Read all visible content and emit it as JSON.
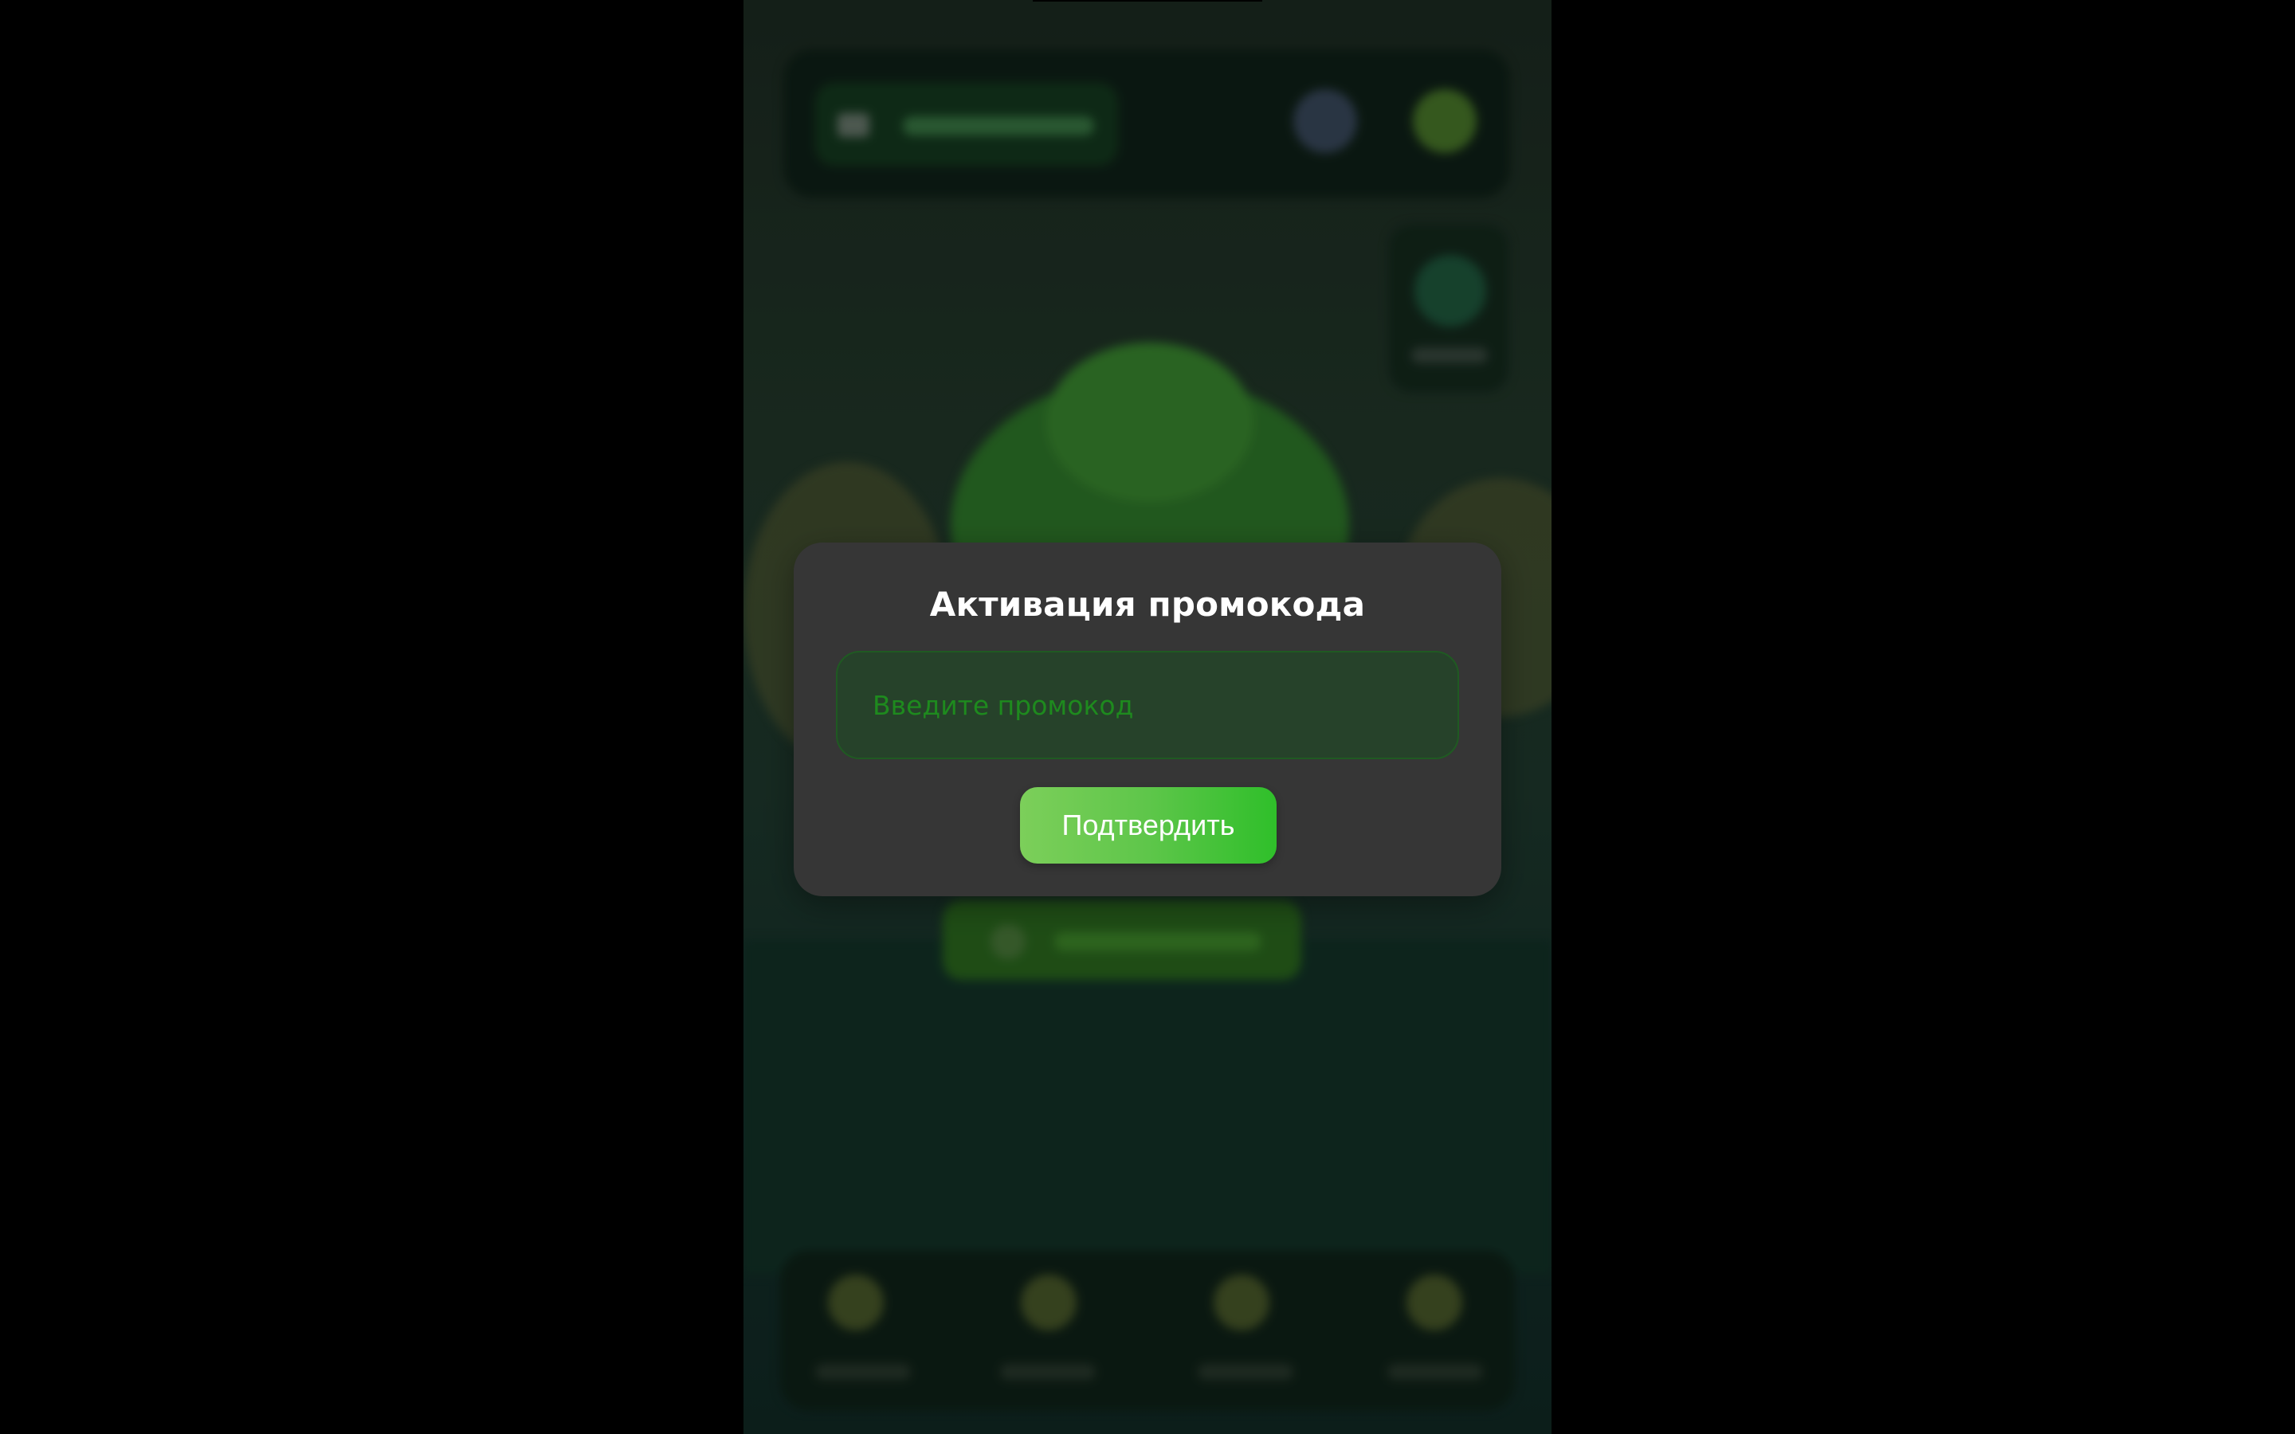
{
  "modal": {
    "title": "Активация промокода",
    "input_value": "",
    "input_placeholder": "Введите промокод",
    "confirm_label": "Подтвердить"
  },
  "colors": {
    "accent": "#3fbf2a",
    "modal_background": "#363636",
    "input_background": "#26422a",
    "placeholder_text": "#1e8a1e"
  },
  "background_icons": [
    "menu-icon",
    "avatar-icon",
    "coin-icon",
    "globe-icon",
    "tree-icon",
    "nav-icon-1",
    "nav-icon-2",
    "nav-icon-3",
    "nav-icon-4"
  ]
}
